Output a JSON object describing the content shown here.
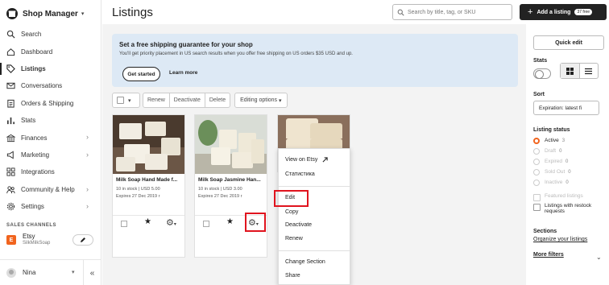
{
  "sidebar": {
    "title": "Shop Manager",
    "items": [
      {
        "label": "Search",
        "icon": "search-icon",
        "arrow": false
      },
      {
        "label": "Dashboard",
        "icon": "home-icon",
        "arrow": false
      },
      {
        "label": "Listings",
        "icon": "tag-icon",
        "arrow": false,
        "active": true
      },
      {
        "label": "Conversations",
        "icon": "mail-icon",
        "arrow": false
      },
      {
        "label": "Orders & Shipping",
        "icon": "clipboard-icon",
        "arrow": false
      },
      {
        "label": "Stats",
        "icon": "bar-chart-icon",
        "arrow": false
      },
      {
        "label": "Finances",
        "icon": "bank-icon",
        "arrow": true
      },
      {
        "label": "Marketing",
        "icon": "megaphone-icon",
        "arrow": true
      },
      {
        "label": "Integrations",
        "icon": "grid-icon",
        "arrow": false
      },
      {
        "label": "Community & Help",
        "icon": "people-icon",
        "arrow": true
      },
      {
        "label": "Settings",
        "icon": "gear-icon",
        "arrow": true
      }
    ],
    "sales_channels_label": "SALES CHANNELS",
    "channel": {
      "badge": "E",
      "name": "Etsy",
      "shop": "SilkMilkSoap"
    },
    "user": {
      "name": "Nina"
    },
    "collapse_glyph": "«"
  },
  "header": {
    "title": "Listings",
    "search_placeholder": "Search by title, tag, or SKU",
    "add_label": "Add a listing",
    "add_count": "37 free"
  },
  "banner": {
    "title": "Set a free shipping guarantee for your shop",
    "subtitle": "You'll get priority placement in US search results when you offer free shipping on US orders $35 USD and up.",
    "primary": "Get started",
    "secondary": "Learn more"
  },
  "toolbar": {
    "renew": "Renew",
    "deactivate": "Deactivate",
    "delete": "Delete",
    "editing_options": "Editing options"
  },
  "cards": [
    {
      "title": "Milk Soap Hand Made f...",
      "stock": "10 in stock",
      "price": "USD 5.00",
      "expires": "Expires 27 Dec 2019 г"
    },
    {
      "title": "Milk Soap Jasmine Han...",
      "stock": "10 in stock",
      "price": "USD 3.00",
      "expires": "Expires 27 Dec 2019 г"
    }
  ],
  "dropdown": {
    "view_on_etsy": "View on Etsy",
    "stats": "Статистика",
    "edit": "Edit",
    "copy": "Copy",
    "deactivate": "Deactivate",
    "renew": "Renew",
    "change_section": "Change Section",
    "share": "Share"
  },
  "right": {
    "quick_edit": "Quick edit",
    "stats_label": "Stats",
    "sort_label": "Sort",
    "sort_value": "Expiration: latest fi",
    "status_label": "Listing status",
    "statuses": [
      {
        "label": "Active",
        "count": "3",
        "active": true
      },
      {
        "label": "Draft",
        "count": "0",
        "active": false
      },
      {
        "label": "Expired",
        "count": "0",
        "active": false
      },
      {
        "label": "Sold Out",
        "count": "0",
        "active": false
      },
      {
        "label": "Inactive",
        "count": "0",
        "active": false
      }
    ],
    "featured": "Featured listings",
    "restock": "Listings with restock requests",
    "sections_label": "Sections",
    "organize": "Organize your listings",
    "more_filters": "More filters"
  },
  "colors": {
    "accent": "#f1641e",
    "highlight": "#e0141e",
    "banner": "#dde9f5"
  }
}
